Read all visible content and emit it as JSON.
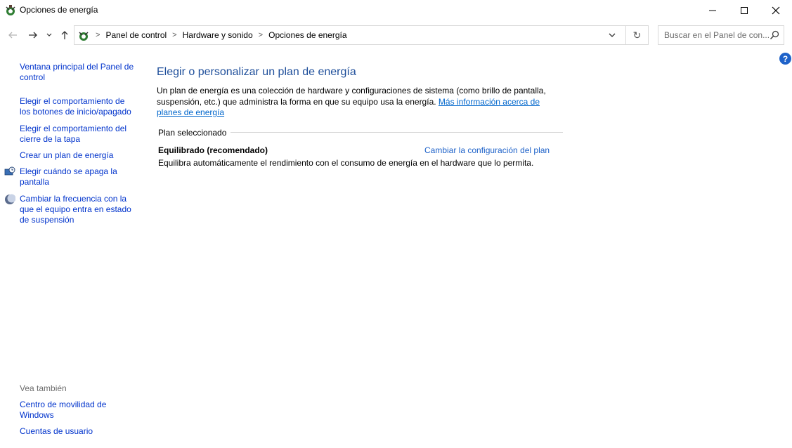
{
  "window": {
    "title": "Opciones de energía",
    "icon": "power-options-icon",
    "controls": [
      "minimize-icon",
      "maximize-icon",
      "close-icon"
    ]
  },
  "navigation": {
    "back_icon": "arrow-left-icon",
    "forward_icon": "arrow-right-icon",
    "recent_icon": "chevron-down-icon",
    "up_icon": "arrow-up-icon",
    "breadcrumbs": [
      "Panel de control",
      "Hardware y sonido",
      "Opciones de energía"
    ],
    "refresh_glyph": "↻",
    "search_placeholder": "Buscar en el Panel de con..."
  },
  "help": {
    "glyph": "?"
  },
  "sidebar": {
    "links": [
      "Ventana principal del Panel de control",
      "Elegir el comportamiento de los botones de inicio/apagado",
      "Elegir el comportamiento del cierre de la tapa",
      "Crear un plan de energía",
      "Elegir cuándo se apaga la pantalla",
      "Cambiar la frecuencia con la que el equipo entra en estado de suspensión"
    ],
    "see_also_label": "Vea también",
    "see_also": [
      "Centro de movilidad de Windows",
      "Cuentas de usuario"
    ]
  },
  "main": {
    "heading": "Elegir o personalizar un plan de energía",
    "description": "Un plan de energía es una colección de hardware y configuraciones de sistema (como brillo de pantalla, suspensión, etc.) que administra la forma en que su equipo usa la energía.",
    "more_info_link": "Más información acerca de planes de energía",
    "plan_group_label": "Plan seleccionado",
    "plan": {
      "name": "Equilibrado (recomendado)",
      "change_link": "Cambiar la configuración del plan",
      "description": "Equilibra automáticamente el rendimiento con el consumo de energía en el hardware que lo permita."
    }
  },
  "colors": {
    "link": "#0033cc",
    "heading": "#1e4e9a",
    "help": "#1e62c9"
  }
}
